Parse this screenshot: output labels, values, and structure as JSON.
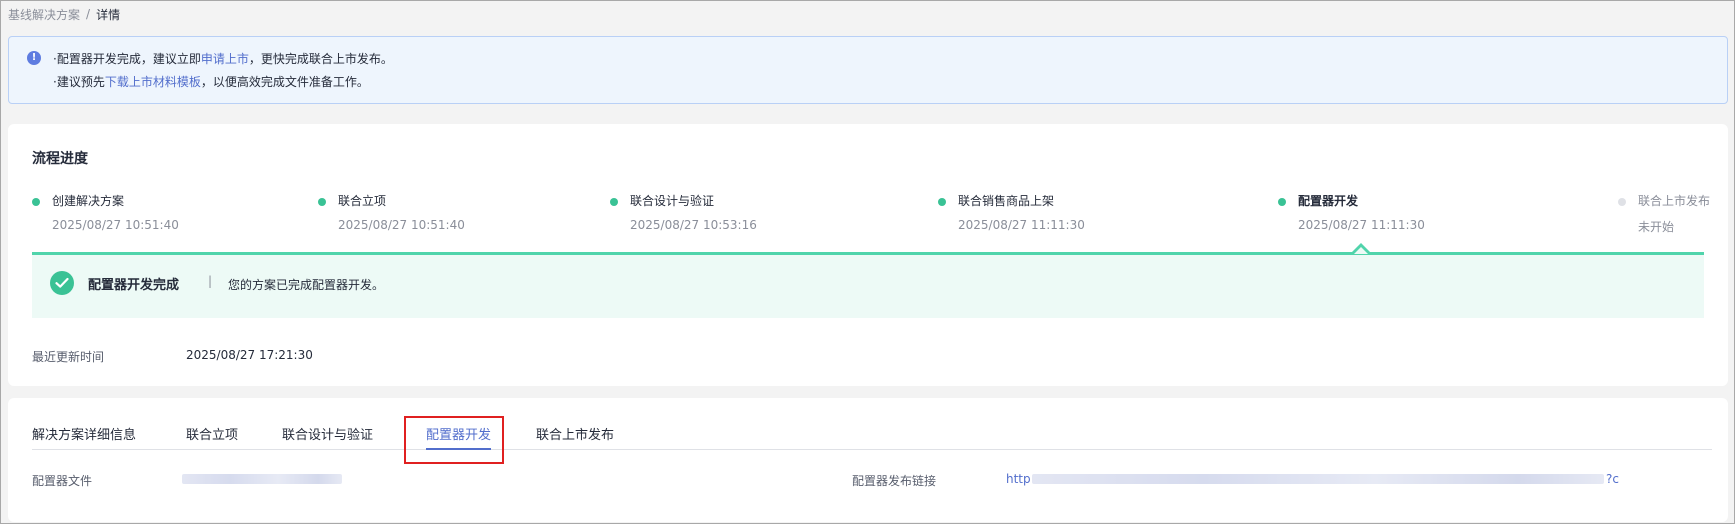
{
  "breadcrumb": {
    "parent": "基线解决方案",
    "separator": "/",
    "current": "详情"
  },
  "notice": {
    "line1_prefix": "·配置器开发完成，建议立即",
    "line1_link": "申请上市",
    "line1_suffix": "，更快完成联合上市发布。",
    "line2_prefix": "·建议预先",
    "line2_link": "下载上市材料模板",
    "line2_suffix": "，以便高效完成文件准备工作。"
  },
  "progress": {
    "title": "流程进度",
    "steps": [
      {
        "name": "创建解决方案",
        "time": "2025/08/27 10:51:40",
        "state": "done"
      },
      {
        "name": "联合立项",
        "time": "2025/08/27 10:51:40",
        "state": "done"
      },
      {
        "name": "联合设计与验证",
        "time": "2025/08/27 10:53:16",
        "state": "done"
      },
      {
        "name": "联合销售商品上架",
        "time": "2025/08/27 11:11:30",
        "state": "done"
      },
      {
        "name": "配置器开发",
        "time": "2025/08/27 11:11:30",
        "state": "active"
      },
      {
        "name": "联合上市发布",
        "time": "未开始",
        "state": "pending"
      }
    ],
    "status": {
      "title": "配置器开发完成",
      "separator": "|",
      "description": "您的方案已完成配置器开发。"
    },
    "last_update_label": "最近更新时间",
    "last_update_value": "2025/08/27 17:21:30"
  },
  "tabs": [
    {
      "label": "解决方案详细信息",
      "active": false
    },
    {
      "label": "联合立项",
      "active": false
    },
    {
      "label": "联合设计与验证",
      "active": false
    },
    {
      "label": "配置器开发",
      "active": true
    },
    {
      "label": "联合上市发布",
      "active": false
    }
  ],
  "details": {
    "config_file_label": "配置器文件",
    "publish_link_label": "配置器发布链接",
    "publish_link_start": "http",
    "publish_link_end": "?c"
  },
  "colors": {
    "accent": "#526ecc",
    "success": "#3ac295",
    "success_bg": "#edfaf6",
    "highlight": "#e02020"
  },
  "icons": {
    "notice": "info-icon",
    "status": "check-circle-icon"
  }
}
